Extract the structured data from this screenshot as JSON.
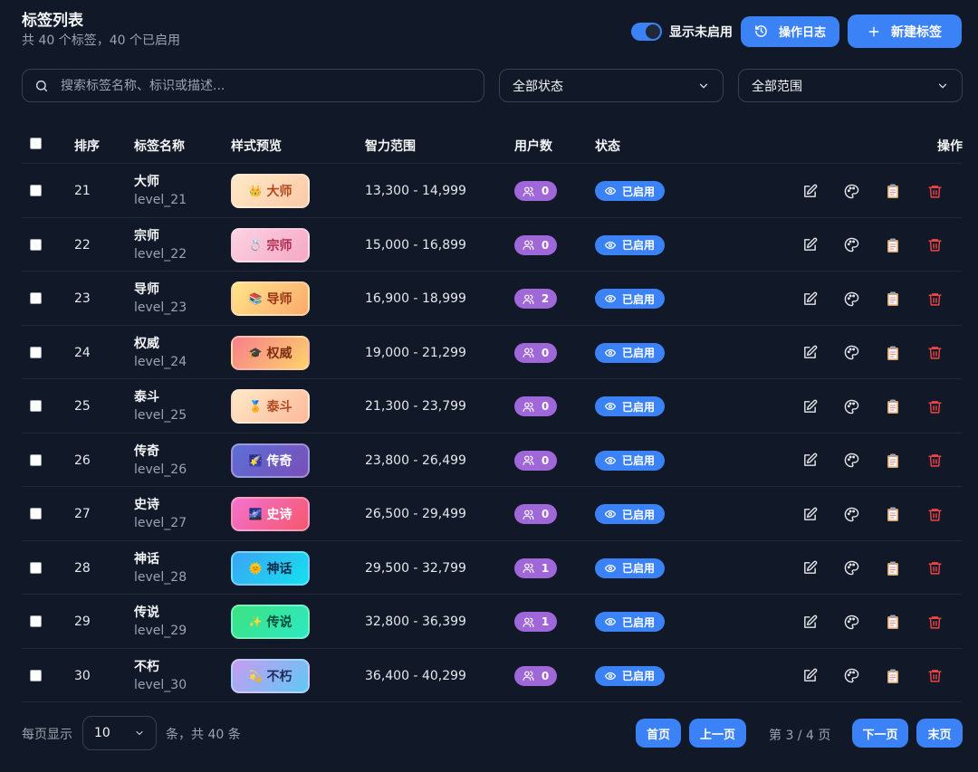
{
  "header": {
    "title": "标签列表",
    "subtitle": "共 40 个标签，40 个已启用",
    "toggle_label": "显示未启用",
    "log_button": "操作日志",
    "new_button": "新建标签"
  },
  "filters": {
    "search_placeholder": "搜索标签名称、标识或描述...",
    "status_select": "全部状态",
    "scope_select": "全部范围"
  },
  "table": {
    "columns": {
      "sort": "排序",
      "name": "标签名称",
      "preview": "样式预览",
      "range": "智力范围",
      "users": "用户数",
      "status": "状态",
      "actions": "操作"
    },
    "rows": [
      {
        "sort": "21",
        "name": "大师",
        "key": "level_21",
        "emoji": "👑",
        "range": "13,300 - 14,999",
        "users": "0",
        "status": "已启用",
        "bg": "linear-gradient(135deg,#ffe9c7,#fbc9a8)",
        "fg": "#b4481c"
      },
      {
        "sort": "22",
        "name": "宗师",
        "key": "level_22",
        "emoji": "💍",
        "range": "15,000 - 16,899",
        "users": "0",
        "status": "已启用",
        "bg": "linear-gradient(135deg,#fbd2e2,#f6a8c4)",
        "fg": "#b12a4f"
      },
      {
        "sort": "23",
        "name": "导师",
        "key": "level_23",
        "emoji": "📚",
        "range": "16,900 - 18,999",
        "users": "2",
        "status": "已启用",
        "bg": "linear-gradient(135deg,#ffe58a,#fba96d)",
        "fg": "#9a3412"
      },
      {
        "sort": "24",
        "name": "权威",
        "key": "level_24",
        "emoji": "🎓",
        "range": "19,000 - 21,299",
        "users": "0",
        "status": "已启用",
        "bg": "linear-gradient(135deg,#f87e8c,#fcd36a)",
        "fg": "#7c2d12"
      },
      {
        "sort": "25",
        "name": "泰斗",
        "key": "level_25",
        "emoji": "🏅",
        "range": "21,300 - 23,799",
        "users": "0",
        "status": "已启用",
        "bg": "linear-gradient(135deg,#ffe9c7,#fbb99a)",
        "fg": "#b4481c"
      },
      {
        "sort": "26",
        "name": "传奇",
        "key": "level_26",
        "emoji": "🌠",
        "range": "23,800 - 26,499",
        "users": "0",
        "status": "已启用",
        "bg": "linear-gradient(135deg,#5b6fd6,#7a4fb8)",
        "fg": "#ffffff"
      },
      {
        "sort": "27",
        "name": "史诗",
        "key": "level_27",
        "emoji": "🌌",
        "range": "26,500 - 29,499",
        "users": "0",
        "status": "已启用",
        "bg": "linear-gradient(135deg,#f472d0,#f5576c)",
        "fg": "#ffffff"
      },
      {
        "sort": "28",
        "name": "神话",
        "key": "level_28",
        "emoji": "🌞",
        "range": "29,500 - 32,799",
        "users": "1",
        "status": "已启用",
        "bg": "linear-gradient(135deg,#3ba4f5,#14e0ef)",
        "fg": "#0f2a44"
      },
      {
        "sort": "29",
        "name": "传说",
        "key": "level_29",
        "emoji": "✨",
        "range": "32,800 - 36,399",
        "users": "1",
        "status": "已启用",
        "bg": "linear-gradient(135deg,#3be37f,#2ee8c4)",
        "fg": "#064e3b"
      },
      {
        "sort": "30",
        "name": "不朽",
        "key": "level_30",
        "emoji": "💫",
        "range": "36,400 - 40,299",
        "users": "0",
        "status": "已启用",
        "bg": "linear-gradient(135deg,#c79cf0,#5fc8f5)",
        "fg": "#1e2a5a"
      }
    ]
  },
  "footer": {
    "per_page_label": "每页显示",
    "per_page_value": "10",
    "total_text": "条，共 40 条",
    "first": "首页",
    "prev": "上一页",
    "page_info": "第 3 / 4 页",
    "next": "下一页",
    "last": "末页"
  },
  "colors": {
    "accent": "#3b82f6",
    "users_badge": "#9f67d8",
    "delete": "#ef4444",
    "background": "#111827"
  }
}
